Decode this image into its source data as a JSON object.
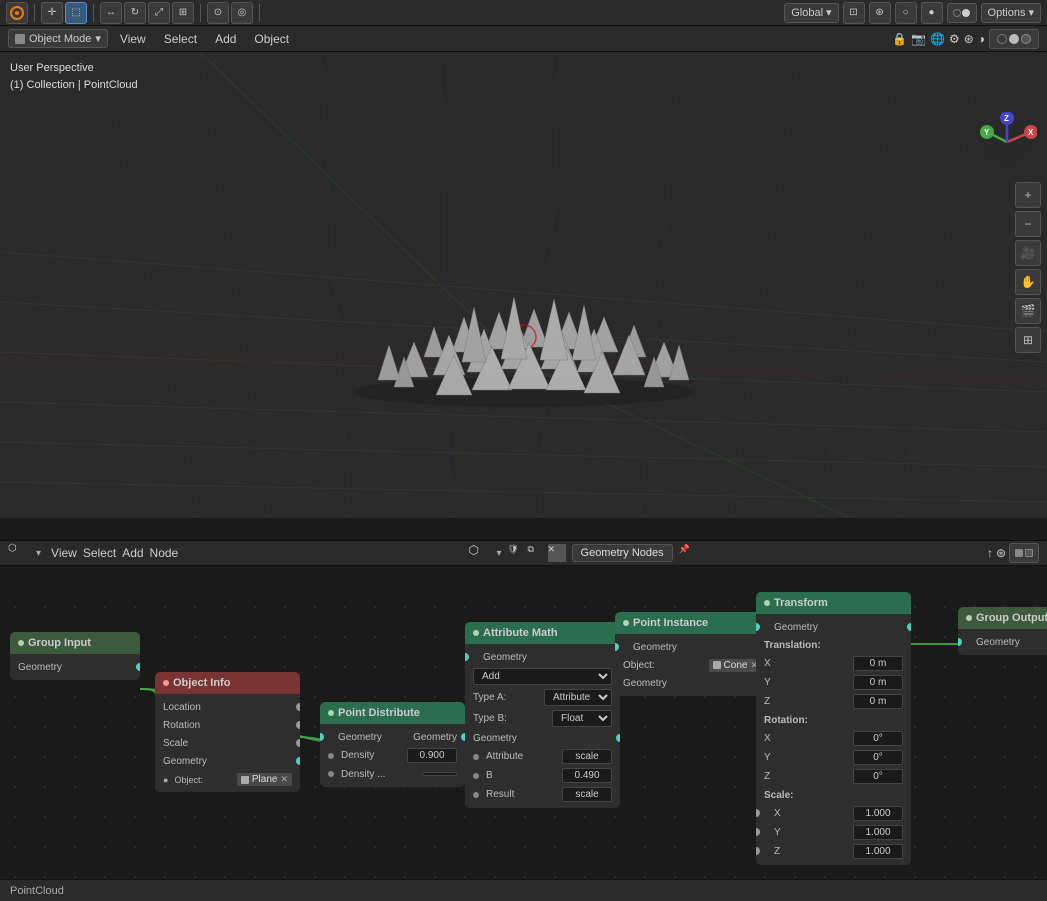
{
  "topToolbar": {
    "icons": [
      "cursor",
      "box-select"
    ],
    "transformIcons": [
      "move",
      "rotate",
      "scale",
      "transform"
    ],
    "snapIcons": [
      "snap",
      "proportional"
    ],
    "globalLabel": "Global",
    "optionsLabel": "Options"
  },
  "headerBar": {
    "modeLabel": "Object Mode",
    "menuItems": [
      "View",
      "Select",
      "Add",
      "Object"
    ]
  },
  "viewport": {
    "perspLabel": "User Perspective",
    "collectionLabel": "(1) Collection | PointCloud"
  },
  "nodeEditor": {
    "menuItems": [
      "View",
      "Select",
      "Add",
      "Node"
    ],
    "editorType": "Geometry Nodes",
    "editorName": "Geometry Nodes"
  },
  "nodes": {
    "groupInput": {
      "title": "Group Input",
      "outputs": [
        "Geometry"
      ]
    },
    "objectInfo": {
      "title": "Object Info",
      "rows": [
        "Location",
        "Rotation",
        "Scale",
        "Geometry"
      ],
      "objectLabel": "Plane"
    },
    "pointDistribute": {
      "title": "Point Distribute",
      "rows": [
        {
          "label": "Geometry",
          "isSocket": true
        },
        {
          "label": "Density",
          "value": "0.900"
        },
        {
          "label": "Density ...",
          "value": ""
        }
      ]
    },
    "attributeMath": {
      "title": "Attribute Math",
      "rows": [
        {
          "label": "Geometry"
        },
        {
          "label": "Add"
        },
        {
          "label": "Type A:",
          "value": "Attribute"
        },
        {
          "label": "Type B:",
          "value": "Float"
        },
        {
          "label": "Geometry"
        },
        {
          "label": "Attribute",
          "value": "scale"
        },
        {
          "label": "B",
          "value": "0.490"
        },
        {
          "label": "Result",
          "value": "scale"
        }
      ]
    },
    "pointInstance": {
      "title": "Point Instance",
      "rows": [
        {
          "label": "Geometry"
        },
        {
          "label": "Object:",
          "value": "Cone"
        },
        {
          "label": "Geometry"
        }
      ]
    },
    "transform": {
      "title": "Transform",
      "rows": [
        {
          "label": "Geometry"
        },
        {
          "label": "Translation:"
        },
        {
          "label": "X",
          "value": "0 m"
        },
        {
          "label": "Y",
          "value": "0 m"
        },
        {
          "label": "Z",
          "value": "0 m"
        },
        {
          "label": "Rotation:"
        },
        {
          "label": "X",
          "value": "0°"
        },
        {
          "label": "Y",
          "value": "0°"
        },
        {
          "label": "Z",
          "value": "0°"
        },
        {
          "label": "Scale:"
        },
        {
          "label": "X",
          "value": "1.000"
        },
        {
          "label": "Y",
          "value": "1.000"
        },
        {
          "label": "Z",
          "value": "1.000"
        }
      ]
    },
    "groupOutput": {
      "title": "Group Output",
      "rows": [
        {
          "label": "Geometry"
        }
      ]
    }
  },
  "statusBar": {
    "label": "PointCloud"
  }
}
